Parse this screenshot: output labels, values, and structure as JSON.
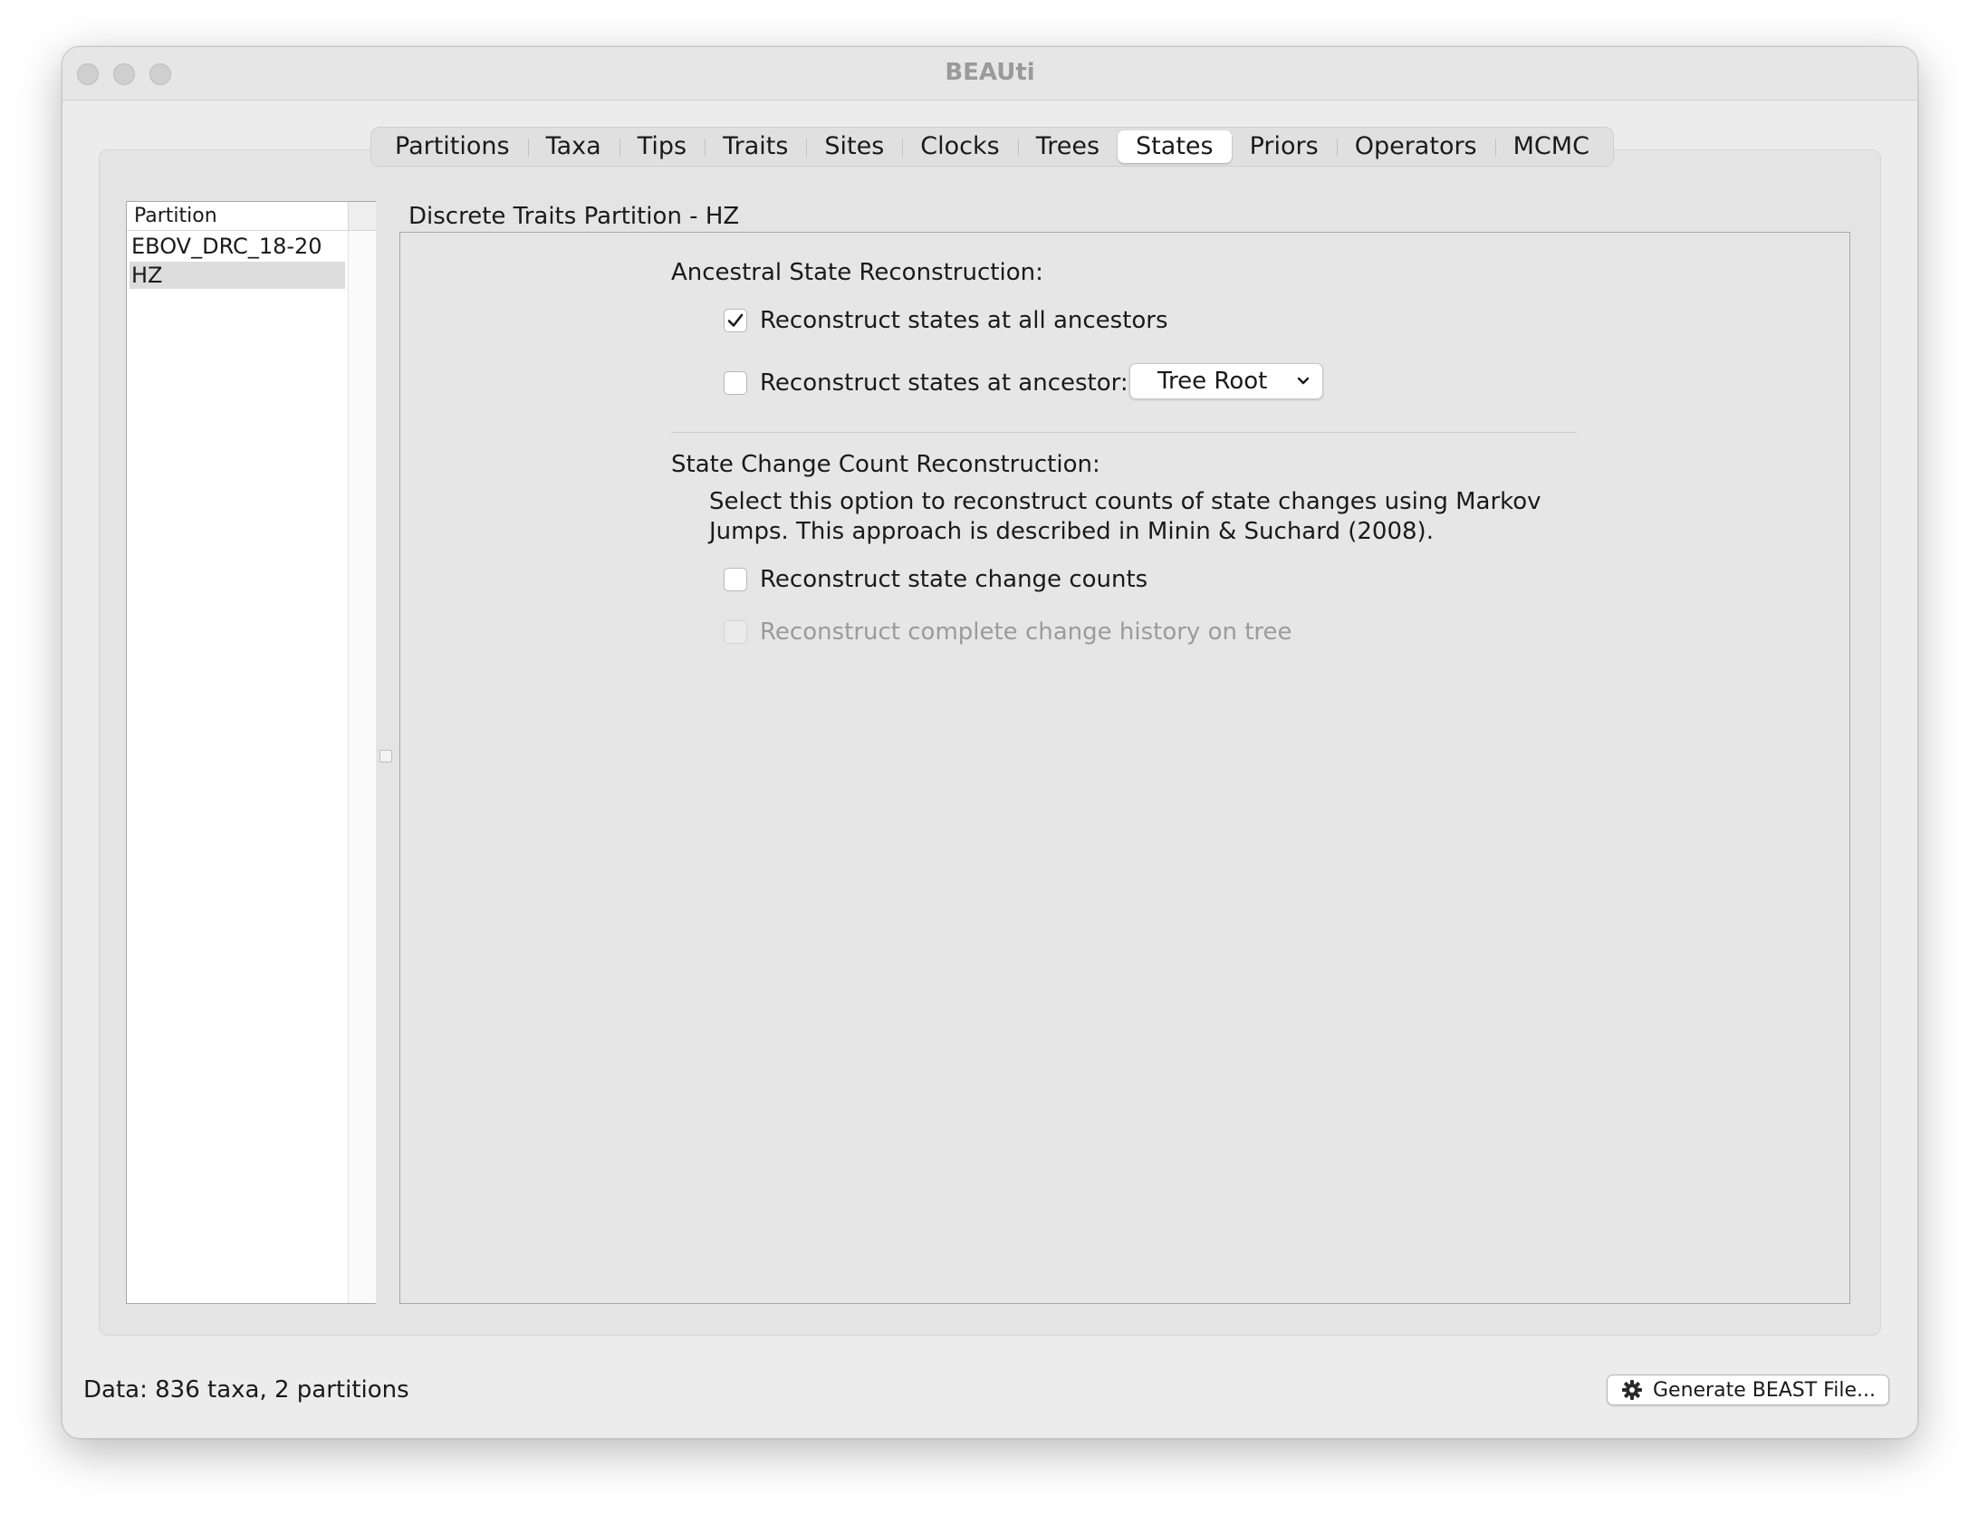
{
  "window": {
    "title": "BEAUti"
  },
  "tabs": [
    {
      "label": "Partitions",
      "active": false
    },
    {
      "label": "Taxa",
      "active": false
    },
    {
      "label": "Tips",
      "active": false
    },
    {
      "label": "Traits",
      "active": false
    },
    {
      "label": "Sites",
      "active": false
    },
    {
      "label": "Clocks",
      "active": false
    },
    {
      "label": "Trees",
      "active": false
    },
    {
      "label": "States",
      "active": true
    },
    {
      "label": "Priors",
      "active": false
    },
    {
      "label": "Operators",
      "active": false
    },
    {
      "label": "MCMC",
      "active": false
    }
  ],
  "partition_list": {
    "header": "Partition",
    "items": [
      {
        "label": "EBOV_DRC_18-20",
        "selected": false
      },
      {
        "label": "HZ",
        "selected": true
      }
    ]
  },
  "panel": {
    "title": "Discrete Traits Partition - HZ",
    "ancestral": {
      "heading": "Ancestral State Reconstruction:",
      "all_ancestors_label": "Reconstruct states at all ancestors",
      "all_ancestors_checked": true,
      "at_ancestor_label": "Reconstruct states at ancestor:",
      "at_ancestor_checked": false,
      "ancestor_select_value": "Tree Root"
    },
    "state_change": {
      "heading": "State Change Count Reconstruction:",
      "description": "Select this option to reconstruct counts of state changes using Markov Jumps. This approach is described in Minin & Suchard (2008).",
      "counts_label": "Reconstruct state change counts",
      "counts_checked": false,
      "history_label": "Reconstruct complete change history on tree",
      "history_checked": false,
      "history_enabled": false
    }
  },
  "status_bar": {
    "text": "Data: 836 taxa, 2 partitions"
  },
  "generate_button": {
    "label": "Generate BEAST File...",
    "icon": "gear-icon"
  }
}
